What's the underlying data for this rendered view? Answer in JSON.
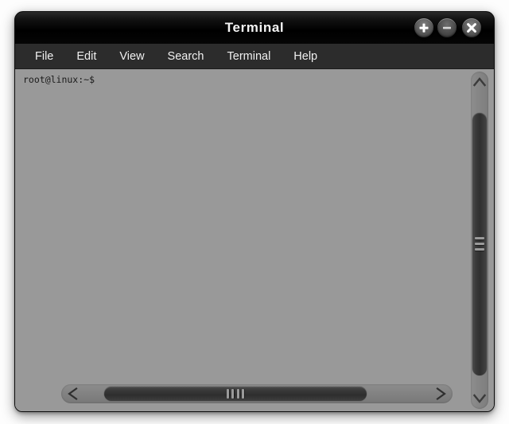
{
  "window": {
    "title": "Terminal",
    "controls": [
      {
        "name": "maximize-button",
        "icon": "plus-icon",
        "label": "+"
      },
      {
        "name": "minimize-button",
        "icon": "minus-icon",
        "label": "–"
      },
      {
        "name": "close-button",
        "icon": "close-icon",
        "label": "×"
      }
    ]
  },
  "menubar": {
    "items": [
      {
        "label": "File"
      },
      {
        "label": "Edit"
      },
      {
        "label": "View"
      },
      {
        "label": "Search"
      },
      {
        "label": "Terminal"
      },
      {
        "label": "Help"
      }
    ]
  },
  "terminal": {
    "prompt": "root@linux:~$",
    "lines": [
      "root@linux:~$"
    ],
    "background_color": "#999999",
    "text_color": "#1a1a1a"
  },
  "scrollbars": {
    "vertical": {
      "up_arrow": "∧",
      "down_arrow": "∨",
      "grip_lines": 3
    },
    "horizontal": {
      "left_arrow": "<",
      "right_arrow": ">",
      "grip_lines": 4
    }
  },
  "colors": {
    "titlebar": "#000000",
    "menubar": "#2c2c2c",
    "terminal_bg": "#999999",
    "thumb": "#333333"
  }
}
